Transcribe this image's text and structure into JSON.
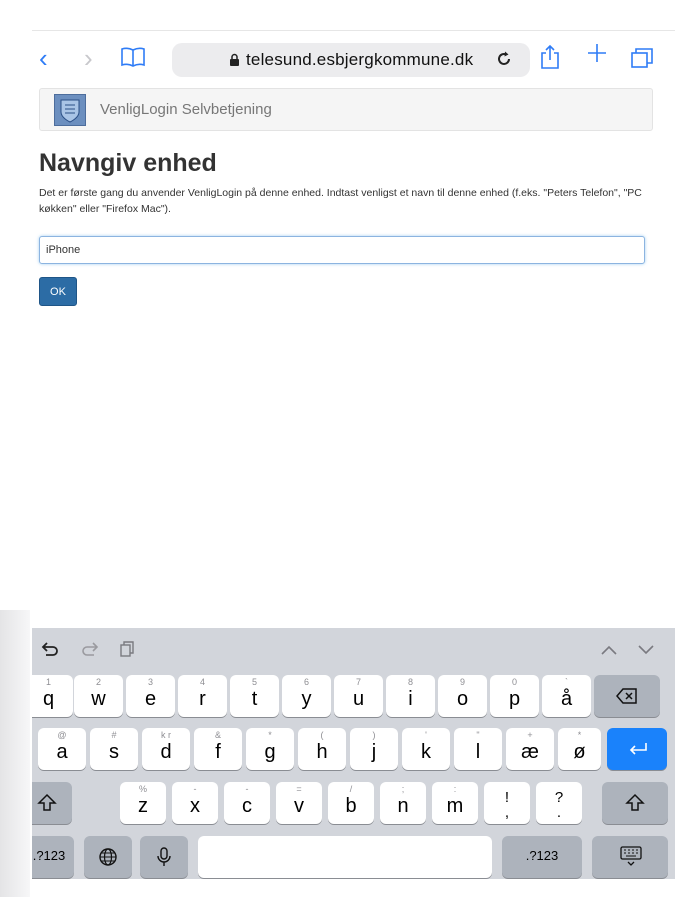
{
  "browser": {
    "url": "telesund.esbjergkommune.dk"
  },
  "header": {
    "brand": "VenligLogin Selvbetjening"
  },
  "page": {
    "title": "Navngiv enhed",
    "instructions": "Det er første gang du anvender VenligLogin på denne enhed. Indtast venligst et navn til denne enhed (f.eks. \"Peters Telefon\", \"PC køkken\" eller \"Firefox Mac\").",
    "device_name_value": "iPhone",
    "ok_label": "OK"
  },
  "keyboard": {
    "row1": [
      {
        "main": "q",
        "hint": "1"
      },
      {
        "main": "w",
        "hint": "2"
      },
      {
        "main": "e",
        "hint": "3"
      },
      {
        "main": "r",
        "hint": "4"
      },
      {
        "main": "t",
        "hint": "5"
      },
      {
        "main": "y",
        "hint": "6"
      },
      {
        "main": "u",
        "hint": "7"
      },
      {
        "main": "i",
        "hint": "8"
      },
      {
        "main": "o",
        "hint": "9"
      },
      {
        "main": "p",
        "hint": "0"
      },
      {
        "main": "å",
        "hint": "`"
      }
    ],
    "row2": [
      {
        "main": "a",
        "hint": "@"
      },
      {
        "main": "s",
        "hint": "#"
      },
      {
        "main": "d",
        "hint": "k r"
      },
      {
        "main": "f",
        "hint": "&"
      },
      {
        "main": "g",
        "hint": "*"
      },
      {
        "main": "h",
        "hint": "("
      },
      {
        "main": "j",
        "hint": ")"
      },
      {
        "main": "k",
        "hint": "'"
      },
      {
        "main": "l",
        "hint": "\""
      },
      {
        "main": "æ",
        "hint": "+"
      },
      {
        "main": "ø",
        "hint": "*"
      }
    ],
    "row3": [
      {
        "main": "z",
        "hint": "%"
      },
      {
        "main": "x",
        "hint": "-"
      },
      {
        "main": "c",
        "hint": "-"
      },
      {
        "main": "v",
        "hint": "="
      },
      {
        "main": "b",
        "hint": "/"
      },
      {
        "main": "n",
        "hint": ";"
      },
      {
        "main": "m",
        "hint": ":"
      },
      {
        "main": "!\n,",
        "hint": ""
      },
      {
        "main": "?\n.",
        "hint": ""
      }
    ],
    "numbers_label": ".?123"
  }
}
